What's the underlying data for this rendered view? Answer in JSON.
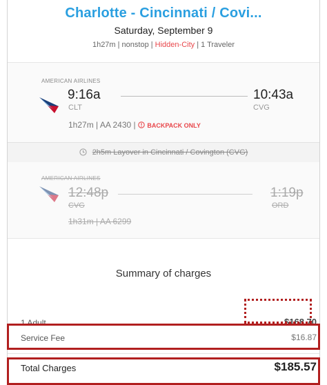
{
  "header": {
    "route_title": "Charlotte - Cincinnati / Covi...",
    "date": "Saturday, September 9",
    "summary_prefix": "1h27m | nonstop | ",
    "hidden_city": "Hidden-City",
    "summary_suffix": " | 1 Traveler"
  },
  "legs": [
    {
      "carrier": "AMERICAN AIRLINES",
      "depart_time": "9:16a",
      "depart_airport": "CLT",
      "arrive_time": "10:43a",
      "arrive_airport": "CVG",
      "details": "1h27m | AA 2430 | ",
      "bag_icon": "info-circle-icon",
      "bag_note": "BACKPACK ONLY"
    },
    {
      "carrier": "AMERICAN AIRLINES",
      "depart_time": "12:48p",
      "depart_airport": "CVG",
      "arrive_time": "1:19p",
      "arrive_airport": "ORD",
      "details": "1h31m | AA 6299"
    }
  ],
  "layover": {
    "icon": "clock-icon",
    "text": "2h5m Layover in Cincinnati / Covington (CVG)"
  },
  "charges": {
    "title": "Summary of charges",
    "adult_label": "1 Adult",
    "adult_value": "$168.70",
    "fee_label": "Service Fee",
    "fee_value": "$16.87",
    "total_label": "Total Charges",
    "total_value": "$185.57"
  },
  "colors": {
    "title_blue": "#2a9fe0",
    "hidden_red": "#e8474b",
    "highlight_red": "#b11f1f"
  }
}
